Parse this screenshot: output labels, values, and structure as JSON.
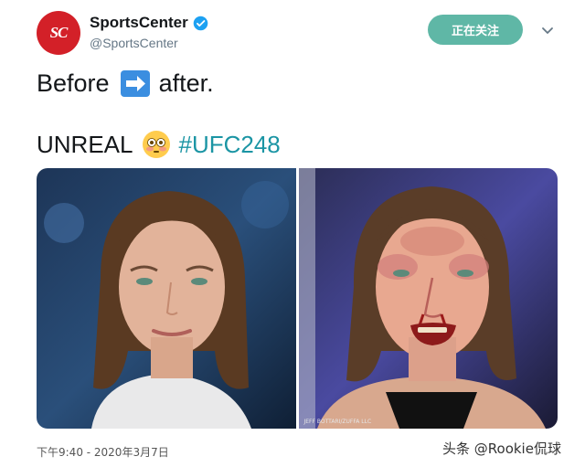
{
  "account": {
    "display_name": "SportsCenter",
    "handle": "@SportsCenter",
    "avatar_text": "SC",
    "verified_icon": "verified-badge-icon"
  },
  "header": {
    "follow_button_label": "正在关注",
    "more_icon": "chevron-down-icon"
  },
  "tweet": {
    "line1_before": "Before",
    "line1_icon": "right-arrow-emoji",
    "line1_after": "after.",
    "line2_text": "UNREAL",
    "line2_icon": "flushed-face-emoji",
    "hashtag": "#UFC248"
  },
  "media": {
    "left_image": "before-fight-portrait",
    "right_image": "after-fight-portrait",
    "credit": "JEFF BOTTARI/ZUFFA LLC"
  },
  "footer": {
    "timestamp": "下午9:40 - 2020年3月7日"
  },
  "watermark": {
    "text": "头条 @Rookie侃球"
  },
  "colors": {
    "brand_red": "#d32028",
    "verified_blue": "#1da1f2",
    "hashtag": "#1b95a4",
    "follow_button": "#5fb7a6"
  }
}
